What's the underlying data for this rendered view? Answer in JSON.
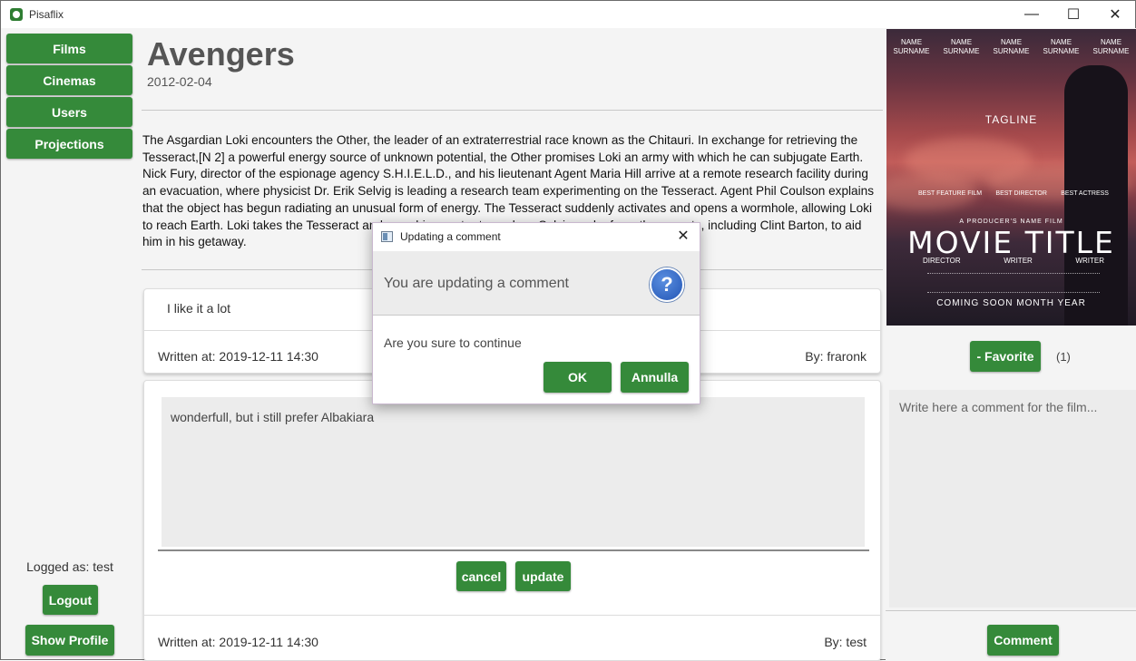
{
  "window": {
    "title": "Pisaflix",
    "minimize": "—",
    "maximize": "☐",
    "close": "✕"
  },
  "sidebar": {
    "items": [
      {
        "label": "Films"
      },
      {
        "label": "Cinemas"
      },
      {
        "label": "Users"
      },
      {
        "label": "Projections"
      }
    ],
    "logged_as": "Logged as: test",
    "logout_label": "Logout",
    "show_profile_label": "Show Profile"
  },
  "film": {
    "title": "Avengers",
    "date": "2012-02-04",
    "plot": "The Asgardian Loki encounters the Other, the leader of an extraterrestrial race known as the Chitauri. In exchange for retrieving the Tesseract,[N 2] a powerful energy source of unknown potential, the Other promises Loki an army with which he can subjugate Earth. Nick Fury, director of the espionage agency S.H.I.E.L.D., and his lieutenant Agent Maria Hill arrive at a remote research facility during an evacuation, where physicist Dr. Erik Selvig is leading a research team experimenting on the Tesseract. Agent Phil Coulson explains that the object has begun radiating an unusual form of energy. The Tesseract suddenly activates and opens a wormhole, allowing Loki to reach Earth. Loki takes the Tesseract and uses his scepter to enslave Selvig and a few other agents, including Clint Barton, to aid him in his getaway."
  },
  "comments": [
    {
      "text": "I like it a lot",
      "written": "Written at: 2019-12-11 14:30",
      "by": "By: fraronk"
    },
    {
      "text": "wonderfull, but i still prefer Albakiara",
      "written": "Written at: 2019-12-11 14:30",
      "by": "By: test"
    }
  ],
  "edit": {
    "cancel_label": "cancel",
    "update_label": "update"
  },
  "poster": {
    "credits": [
      "NAME SURNAME",
      "NAME SURNAME",
      "NAME SURNAME",
      "NAME SURNAME",
      "NAME SURNAME"
    ],
    "tagline": "TAGLINE",
    "awards": [
      "BEST FEATURE FILM",
      "BEST DIRECTOR",
      "BEST ACTRESS"
    ],
    "producer": "A PRODUCER'S NAME FILM",
    "movie_title": "MOVIE TITLE",
    "roles": [
      "DIRECTOR",
      "WRITER",
      "WRITER"
    ],
    "coming": "COMING SOON   MONTH YEAR"
  },
  "right_panel": {
    "favorite_label": "- Favorite",
    "favorite_count": "(1)",
    "comment_placeholder": "Write here a comment for the film...",
    "comment_label": "Comment"
  },
  "dialog": {
    "title": "Updating a comment",
    "close": "✕",
    "header": "You are updating a comment",
    "icon": "?",
    "body": "Are you sure to continue",
    "ok_label": "OK",
    "cancel_label": "Annulla"
  },
  "colors": {
    "accent": "#358a3a",
    "question_icon": "#2255b5"
  }
}
